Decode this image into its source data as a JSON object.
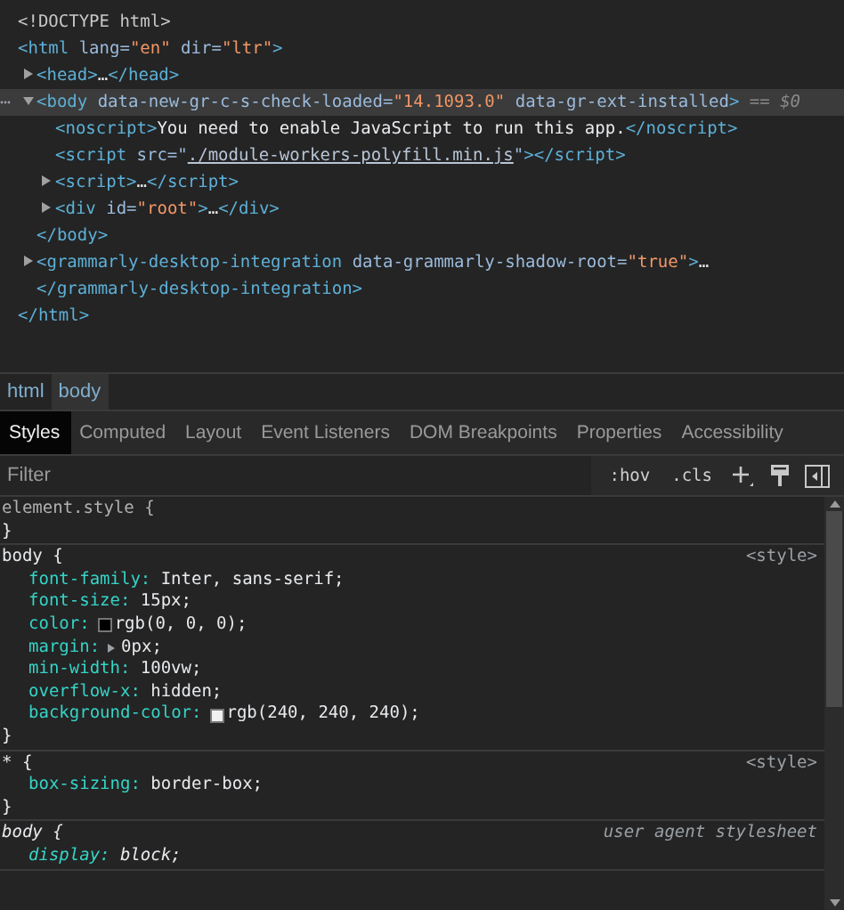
{
  "dom_tree": [
    {
      "tokens": [
        {
          "kind": "doctype",
          "text": "<!DOCTYPE html>"
        }
      ]
    },
    {
      "tokens": [
        {
          "kind": "tag",
          "text": "<html"
        },
        {
          "kind": "attr",
          "text": " lang="
        },
        {
          "kind": "value",
          "text": "\"en\""
        },
        {
          "kind": "attr",
          "text": " dir="
        },
        {
          "kind": "value",
          "text": "\"ltr\""
        },
        {
          "kind": "tag",
          "text": ">"
        }
      ],
      "closing": "</html>",
      "children": [
        {
          "expanded": false,
          "selected": false,
          "tokens": [
            {
              "kind": "tag",
              "text": "<head>"
            },
            {
              "kind": "text",
              "text": "…"
            },
            {
              "kind": "tag",
              "text": "</head>"
            }
          ]
        },
        {
          "expanded": true,
          "selected": true,
          "marker": " == $0",
          "tokens": [
            {
              "kind": "tag",
              "text": "<body"
            },
            {
              "kind": "attr",
              "text": " data-new-gr-c-s-check-loaded="
            },
            {
              "kind": "value",
              "text": "\"14.1093.0\""
            },
            {
              "kind": "attr",
              "text": " data-gr-ext-installed"
            },
            {
              "kind": "tag",
              "text": ">"
            }
          ],
          "closing": "</body>",
          "children": [
            {
              "tokens": [
                {
                  "kind": "tag",
                  "text": "<noscript>"
                },
                {
                  "kind": "text",
                  "text": "You need to enable JavaScript to run this app."
                },
                {
                  "kind": "tag",
                  "text": "</noscript>"
                }
              ]
            },
            {
              "tokens": [
                {
                  "kind": "tag",
                  "text": "<script"
                },
                {
                  "kind": "attr",
                  "text": " src=\""
                },
                {
                  "kind": "link",
                  "text": "./module-workers-polyfill.min.js"
                },
                {
                  "kind": "attr",
                  "text": "\""
                },
                {
                  "kind": "tag",
                  "text": "></script>"
                }
              ]
            },
            {
              "expanded": false,
              "selected": false,
              "tokens": [
                {
                  "kind": "tag",
                  "text": "<script>"
                },
                {
                  "kind": "text",
                  "text": "…"
                },
                {
                  "kind": "tag",
                  "text": "</script>"
                }
              ]
            },
            {
              "expanded": false,
              "selected": false,
              "tokens": [
                {
                  "kind": "tag",
                  "text": "<div"
                },
                {
                  "kind": "attr",
                  "text": " id="
                },
                {
                  "kind": "value",
                  "text": "\"root\""
                },
                {
                  "kind": "tag",
                  "text": ">"
                },
                {
                  "kind": "text",
                  "text": "…"
                },
                {
                  "kind": "tag",
                  "text": "</div>"
                }
              ]
            }
          ]
        },
        {
          "expanded": false,
          "selected": false,
          "tokens": [
            {
              "kind": "tag",
              "text": "<grammarly-desktop-integration"
            },
            {
              "kind": "attr",
              "text": " data-grammarly-shadow-root="
            },
            {
              "kind": "value",
              "text": "\"true\""
            },
            {
              "kind": "tag",
              "text": ">"
            },
            {
              "kind": "text",
              "text": "…"
            },
            {
              "kind": "tag",
              "text": "</grammarly-desktop-integration>"
            }
          ]
        }
      ]
    }
  ],
  "breadcrumbs": [
    {
      "label": "html",
      "selected": false
    },
    {
      "label": "body",
      "selected": true
    }
  ],
  "tabs": [
    {
      "label": "Styles",
      "selected": true
    },
    {
      "label": "Computed",
      "selected": false
    },
    {
      "label": "Layout",
      "selected": false
    },
    {
      "label": "Event Listeners",
      "selected": false
    },
    {
      "label": "DOM Breakpoints",
      "selected": false
    },
    {
      "label": "Properties",
      "selected": false
    },
    {
      "label": "Accessibility",
      "selected": false
    }
  ],
  "filter": {
    "placeholder": "Filter",
    "buttons": [
      ":hov",
      ".cls"
    ]
  },
  "rules": [
    {
      "selector": "element.style {",
      "kind": "inline",
      "closing": "}"
    },
    {
      "selector": "body {",
      "kind": "author",
      "source": "<style>",
      "closing": "}",
      "declarations": [
        {
          "kind": "plain",
          "property": "font-family:",
          "value": "Inter, sans-serif;"
        },
        {
          "kind": "plain",
          "property": "font-size:",
          "value": "15px;"
        },
        {
          "kind": "color",
          "property": "color:",
          "value": "rgb(0, 0, 0);",
          "color": "#000000"
        },
        {
          "kind": "shorthand",
          "property": "margin:",
          "value": "0px;",
          "expanded": false
        },
        {
          "kind": "plain",
          "property": "min-width:",
          "value": "100vw;"
        },
        {
          "kind": "plain",
          "property": "overflow-x:",
          "value": "hidden;"
        },
        {
          "kind": "color",
          "property": "background-color:",
          "value": "rgb(240, 240, 240);",
          "color": "#f0f0f0"
        }
      ]
    },
    {
      "selector": "* {",
      "kind": "author",
      "source": "<style>",
      "closing": "}",
      "declarations": [
        {
          "kind": "plain",
          "property": "box-sizing:",
          "value": "border-box;"
        }
      ]
    },
    {
      "selector": "body {",
      "kind": "user-agent",
      "source": "user agent stylesheet",
      "declarations": [
        {
          "kind": "plain",
          "property": "display:",
          "value": "block;"
        }
      ]
    }
  ]
}
